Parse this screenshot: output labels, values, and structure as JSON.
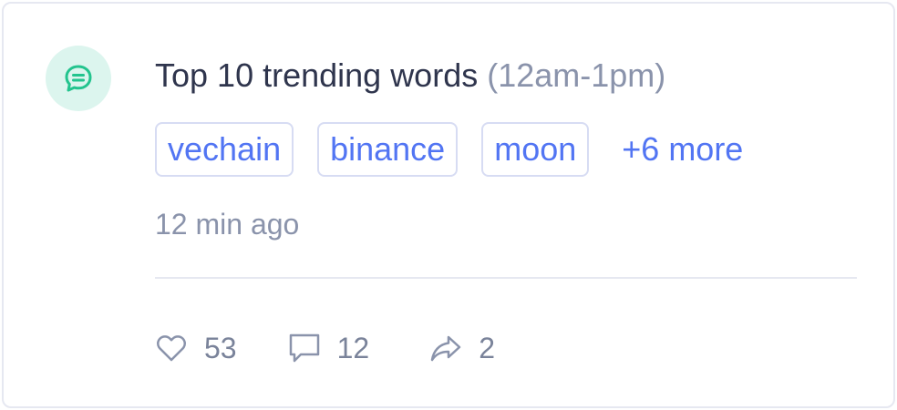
{
  "card": {
    "icon": "chat-bubble-icon",
    "title": "Top 10 trending words",
    "title_range": "(12am-1pm)",
    "tags": [
      {
        "label": "vechain"
      },
      {
        "label": "binance"
      },
      {
        "label": "moon"
      }
    ],
    "more_label": "+6 more",
    "time_ago": "12 min ago",
    "actions": {
      "likes": "53",
      "comments": "12",
      "shares": "2"
    }
  },
  "colors": {
    "accent": "#5275f3",
    "avatar_bg": "#dcf5ee",
    "avatar_icon": "#23c48e",
    "muted": "#8a93ab",
    "title": "#2f354d",
    "border": "#e6e8f1"
  }
}
